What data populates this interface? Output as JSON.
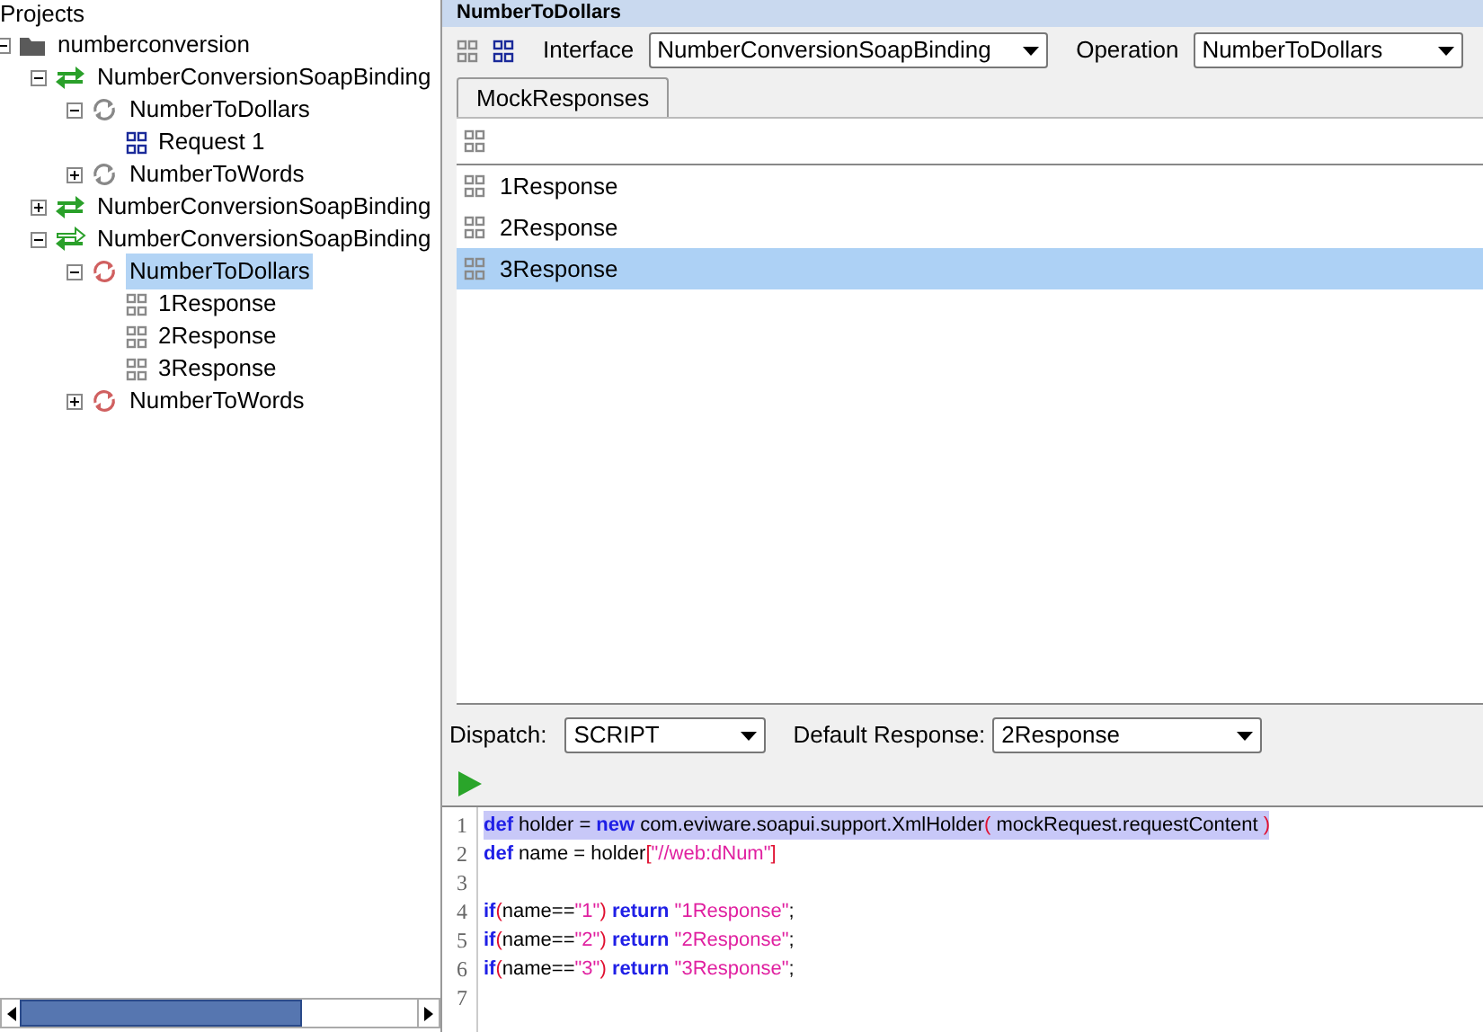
{
  "tree": {
    "header": "Projects",
    "items": [
      {
        "label": "numberconversion",
        "kind": "folder",
        "expanded": true,
        "selected": false,
        "children": [
          {
            "label": "NumberConversionSoapBinding",
            "kind": "binding",
            "expanded": true,
            "selected": false,
            "children": [
              {
                "label": "NumberToDollars",
                "kind": "operation",
                "expanded": true,
                "selected": false,
                "children": [
                  {
                    "label": "Request 1",
                    "kind": "request",
                    "selected": false
                  }
                ]
              },
              {
                "label": "NumberToWords",
                "kind": "operation",
                "expanded": false,
                "selected": false
              }
            ]
          },
          {
            "label": "NumberConversionSoapBinding",
            "kind": "binding",
            "expanded": false,
            "selected": false
          },
          {
            "label": "NumberConversionSoapBinding",
            "kind": "mockservice",
            "expanded": true,
            "selected": false,
            "children": [
              {
                "label": "NumberToDollars",
                "kind": "mockoperation",
                "expanded": true,
                "selected": true,
                "children": [
                  {
                    "label": "1Response",
                    "kind": "response",
                    "selected": false
                  },
                  {
                    "label": "2Response",
                    "kind": "response",
                    "selected": false
                  },
                  {
                    "label": "3Response",
                    "kind": "response",
                    "selected": false
                  }
                ]
              },
              {
                "label": "NumberToWords",
                "kind": "mockoperation",
                "expanded": false,
                "selected": false
              }
            ]
          }
        ]
      }
    ]
  },
  "editor": {
    "title": "NumberToDollars",
    "interface": {
      "label": "Interface",
      "value": "NumberConversionSoapBinding"
    },
    "operation": {
      "label": "Operation",
      "value": "NumberToDollars"
    },
    "tabs": [
      {
        "label": "MockResponses",
        "selected": true
      }
    ],
    "responses": [
      {
        "label": "1Response",
        "selected": false
      },
      {
        "label": "2Response",
        "selected": false
      },
      {
        "label": "3Response",
        "selected": true
      }
    ],
    "dispatch": {
      "label": "Dispatch:",
      "value": "SCRIPT"
    },
    "default_response": {
      "label": "Default Response:",
      "value": "2Response"
    },
    "script": [
      {
        "number": "1",
        "highlighted": true,
        "segments": [
          {
            "kind": "keyword",
            "text": "def"
          },
          {
            "kind": "plain",
            "text": " holder = "
          },
          {
            "kind": "keyword",
            "text": "new"
          },
          {
            "kind": "plain",
            "text": " com.eviware.soapui.support.XmlHolder"
          },
          {
            "kind": "paren",
            "text": "("
          },
          {
            "kind": "plain",
            "text": " mockRequest.requestContent "
          },
          {
            "kind": "paren",
            "text": ")"
          }
        ]
      },
      {
        "number": "2",
        "highlighted": false,
        "segments": [
          {
            "kind": "keyword",
            "text": "def"
          },
          {
            "kind": "plain",
            "text": " name = holder"
          },
          {
            "kind": "paren",
            "text": "["
          },
          {
            "kind": "string",
            "text": "\"//web:dNum\""
          },
          {
            "kind": "paren",
            "text": "]"
          }
        ]
      },
      {
        "number": "3"
      },
      {
        "number": "4",
        "highlighted": false,
        "segments": [
          {
            "kind": "keyword",
            "text": "if"
          },
          {
            "kind": "paren",
            "text": "("
          },
          {
            "kind": "plain",
            "text": "name=="
          },
          {
            "kind": "string",
            "text": "\"1\""
          },
          {
            "kind": "paren",
            "text": ")"
          },
          {
            "kind": "keyword",
            "text": " return"
          },
          {
            "kind": "string",
            "text": " \"1Response\""
          },
          {
            "kind": "plain",
            "text": ";"
          }
        ]
      },
      {
        "number": "5",
        "highlighted": false,
        "segments": [
          {
            "kind": "keyword",
            "text": "if"
          },
          {
            "kind": "paren",
            "text": "("
          },
          {
            "kind": "plain",
            "text": "name=="
          },
          {
            "kind": "string",
            "text": "\"2\""
          },
          {
            "kind": "paren",
            "text": ")"
          },
          {
            "kind": "keyword",
            "text": " return"
          },
          {
            "kind": "string",
            "text": " \"2Response\""
          },
          {
            "kind": "plain",
            "text": ";"
          }
        ]
      },
      {
        "number": "6",
        "highlighted": false,
        "segments": [
          {
            "kind": "keyword",
            "text": "if"
          },
          {
            "kind": "paren",
            "text": "("
          },
          {
            "kind": "plain",
            "text": "name=="
          },
          {
            "kind": "string",
            "text": "\"3\""
          },
          {
            "kind": "paren",
            "text": ")"
          },
          {
            "kind": "keyword",
            "text": " return"
          },
          {
            "kind": "string",
            "text": " \"3Response\""
          },
          {
            "kind": "plain",
            "text": ";"
          }
        ]
      },
      {
        "number": "7"
      }
    ]
  }
}
